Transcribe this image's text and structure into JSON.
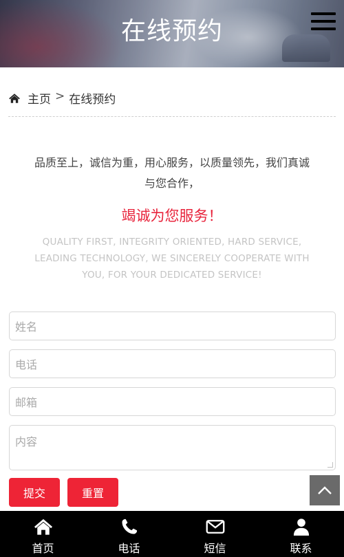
{
  "banner": {
    "title": "在线预约"
  },
  "breadcrumb": {
    "home": "主页",
    "separator": ">",
    "current": "在线预约"
  },
  "intro": {
    "line1": "品质至上，诚信为重，用心服务，以质量领先，我们真诚",
    "line2": "与您合作，",
    "slogan": "竭诚为您服务！",
    "english_line1": "QUALITY FIRST, INTEGRITY ORIENTED, HARD SERVICE,",
    "english_line2": "LEADING TECHNOLOGY, WE SINCERELY COOPERATE WITH",
    "english_line3": "YOU, FOR YOUR DEDICATED SERVICE!"
  },
  "form": {
    "name_placeholder": "姓名",
    "phone_placeholder": "电话",
    "email_placeholder": "邮箱",
    "content_placeholder": "内容",
    "submit_label": "提交",
    "reset_label": "重置"
  },
  "bottom_nav": {
    "items": [
      {
        "label": "首页",
        "icon": "home-icon"
      },
      {
        "label": "电话",
        "icon": "phone-icon"
      },
      {
        "label": "短信",
        "icon": "envelope-icon"
      },
      {
        "label": "联系",
        "icon": "user-icon"
      }
    ]
  },
  "colors": {
    "accent": "#ee2436",
    "slogan": "#e8243c",
    "nav_bg": "#000000",
    "back_top": "#6a6a6a"
  }
}
